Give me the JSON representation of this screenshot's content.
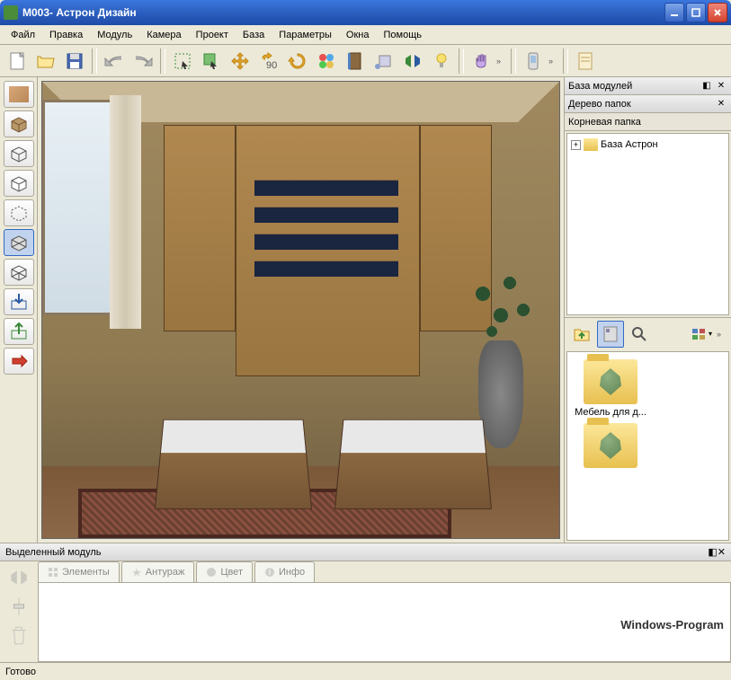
{
  "window": {
    "title": "M003- Астрон Дизайн"
  },
  "menu": {
    "items": [
      "Файл",
      "Правка",
      "Модуль",
      "Камера",
      "Проект",
      "База",
      "Параметры",
      "Окна",
      "Помощь"
    ]
  },
  "toolbar": {
    "icons": [
      "new-doc",
      "open-folder",
      "save",
      "undo",
      "redo",
      "select-rect",
      "select-cursor",
      "move",
      "rotate-90",
      "rotate",
      "color-flower",
      "door",
      "render",
      "mirror",
      "light",
      "hand",
      "phone",
      "note"
    ]
  },
  "left_tools": {
    "icons": [
      "material-brown",
      "box-solid",
      "box-wire",
      "box-open",
      "box-dashed",
      "box-diag",
      "box-3d",
      "arrow-in-down",
      "arrow-out-up",
      "arrow-right-red"
    ]
  },
  "right_panel": {
    "modules_title": "База модулей",
    "tree_title": "Дерево папок",
    "root_label": "Корневая папка",
    "tree_items": [
      {
        "label": "База Астрон"
      }
    ]
  },
  "catalog": {
    "items": [
      {
        "label": "Мебель для д..."
      },
      {
        "label": ""
      }
    ]
  },
  "bottom_panel": {
    "title": "Выделенный модуль",
    "tabs": [
      "Элементы",
      "Антураж",
      "Цвет",
      "Инфо"
    ]
  },
  "status": {
    "text": "Готово"
  },
  "watermark": "Windows-Program"
}
